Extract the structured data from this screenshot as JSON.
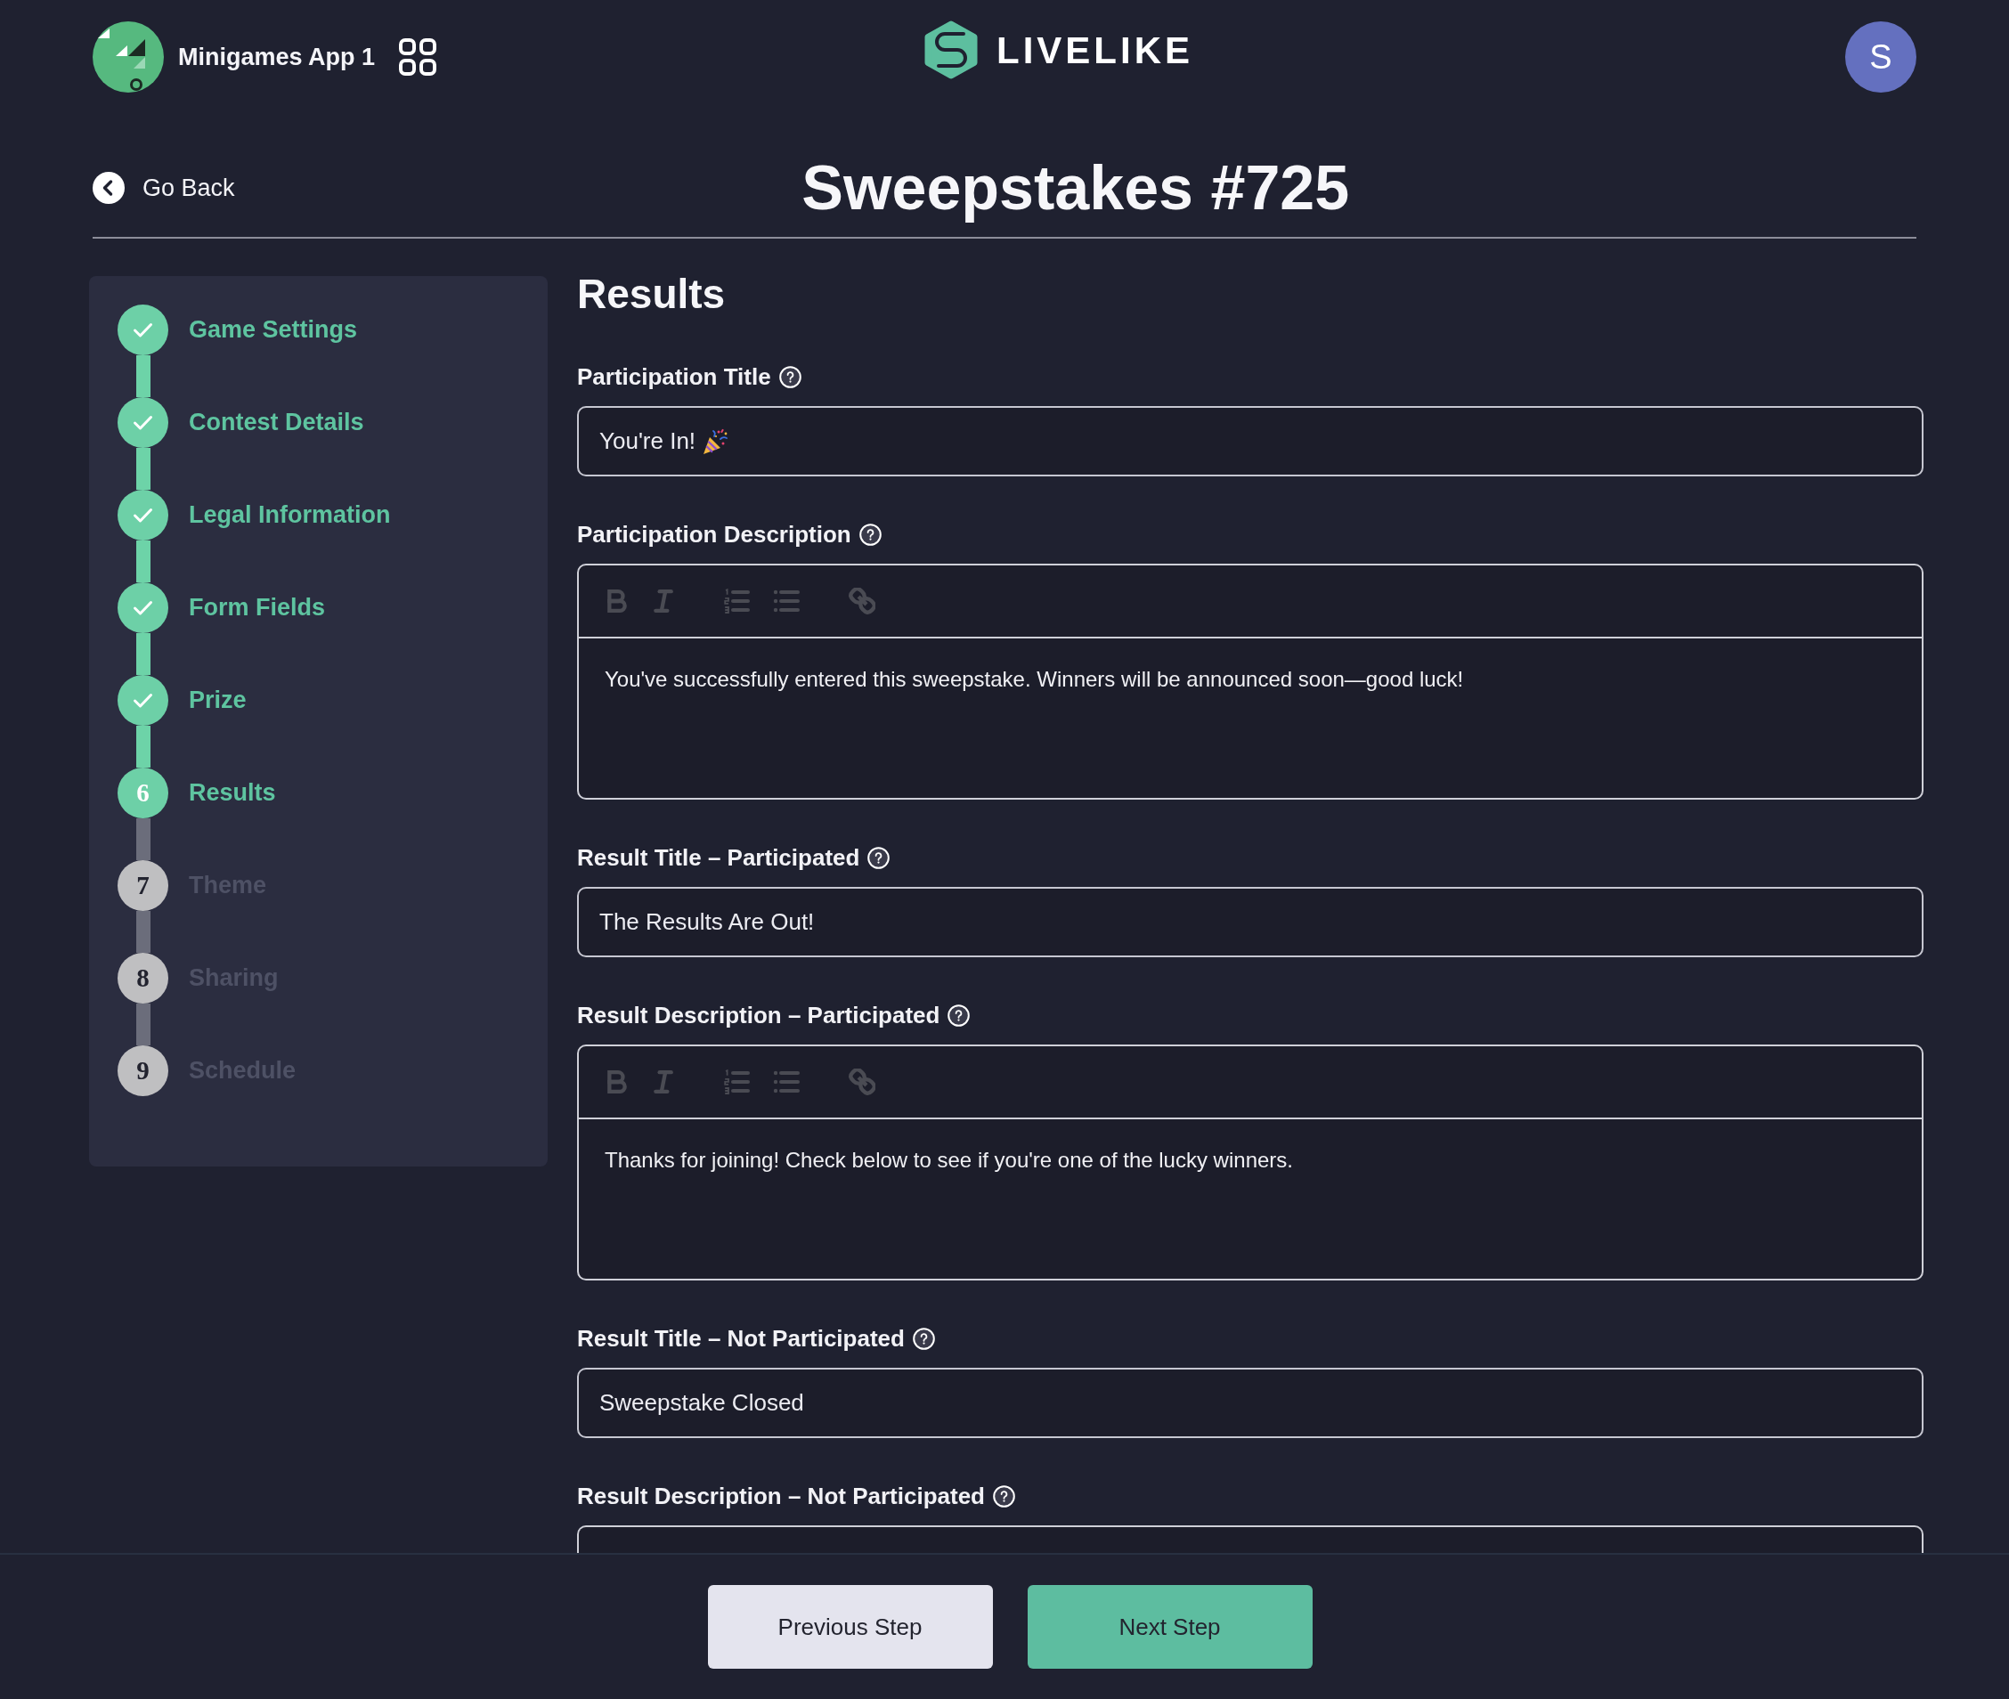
{
  "app": {
    "name": "Minigames App 1"
  },
  "brand": {
    "wordmark": "LIVELIKE"
  },
  "user": {
    "initial": "S"
  },
  "nav": {
    "back_label": "Go Back"
  },
  "page": {
    "title": "Sweepstakes #725"
  },
  "steps": [
    {
      "label": "Game Settings",
      "selected": false
    },
    {
      "label": "Contest Details",
      "selected": false
    },
    {
      "label": "Legal Information",
      "selected": false
    },
    {
      "label": "Form Fields",
      "selected": false
    },
    {
      "label": "Prize",
      "selected": false
    },
    {
      "label": "Results",
      "number": "6",
      "selected": true
    },
    {
      "label": "Theme",
      "number": "7",
      "selected": false
    },
    {
      "label": "Sharing",
      "number": "8",
      "selected": false
    },
    {
      "label": "Schedule",
      "number": "9",
      "selected": false
    }
  ],
  "section": {
    "title": "Results"
  },
  "fields": [
    {
      "kind": "input",
      "label": "Participation Title",
      "value": "You're In!",
      "emoji": true
    },
    {
      "kind": "editor",
      "label": "Participation Description",
      "value": "You've successfully entered this sweepstake. Winners will be announced soon—good luck!",
      "emoji": false,
      "cut_off": false
    },
    {
      "kind": "input",
      "label": "Result Title – Participated",
      "value": "The Results Are Out!",
      "emoji": false
    },
    {
      "kind": "editor",
      "label": "Result Description – Participated",
      "value": "Thanks for joining! Check below to see if you're one of the lucky winners.",
      "emoji": false,
      "cut_off": false
    },
    {
      "kind": "input",
      "label": "Result Title – Not Participated",
      "value": "Sweepstake Closed",
      "emoji": false
    },
    {
      "kind": "editor",
      "label": "Result Description – Not Participated",
      "emoji": false,
      "cut_off": true
    }
  ],
  "footer": {
    "buttons": [
      {
        "label": "Previous Step",
        "kind": "secondary"
      },
      {
        "label": "Next Step",
        "kind": "primary"
      }
    ]
  }
}
